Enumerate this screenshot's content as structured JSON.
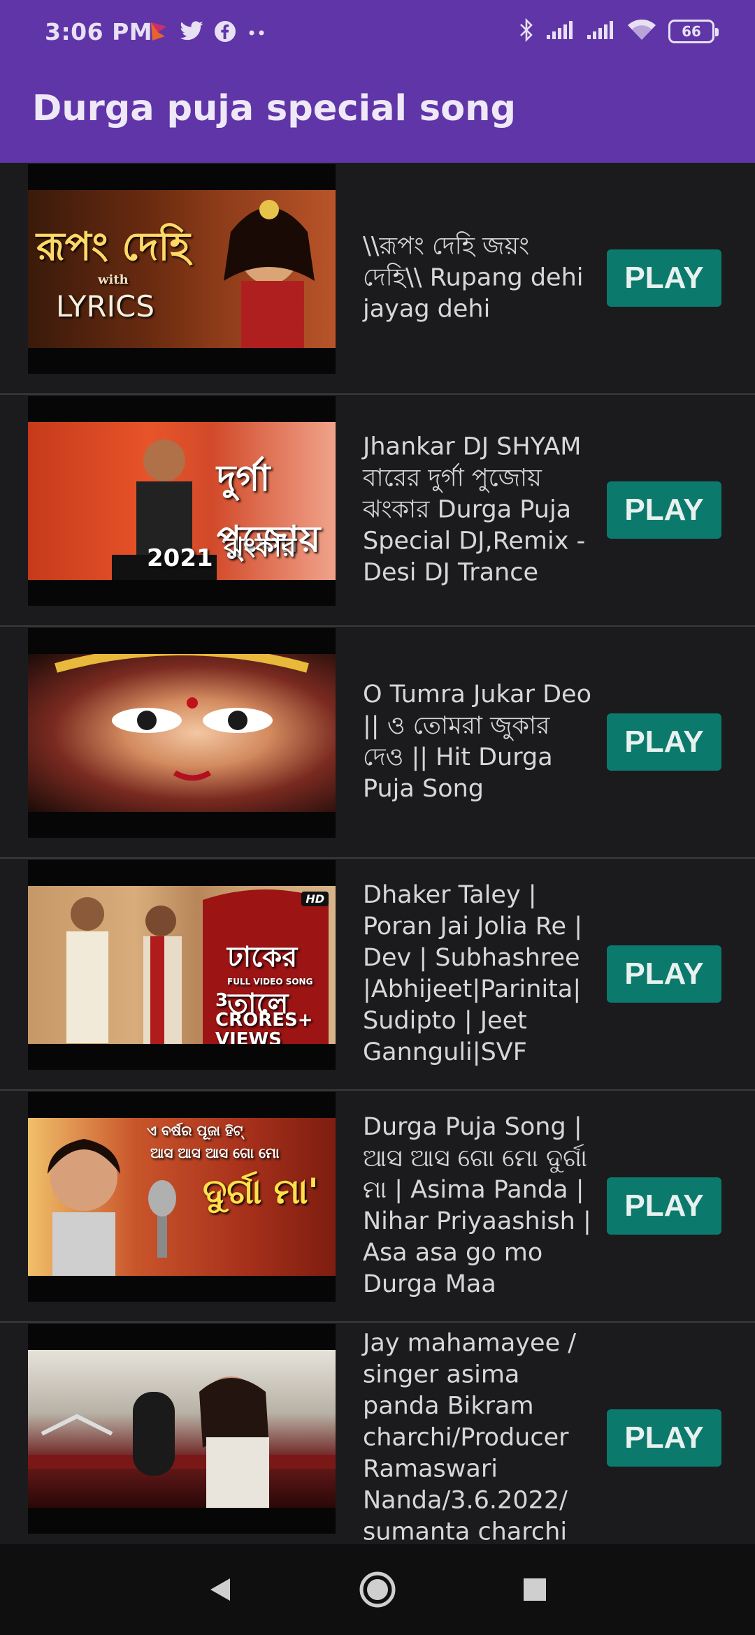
{
  "status_bar": {
    "time": "3:06 PM",
    "battery_level": "66",
    "left_icons": [
      "app-notification-icon",
      "twitter-icon",
      "facebook-icon",
      "more-dots-icon"
    ],
    "right_icons": [
      "bluetooth-icon",
      "signal-icon",
      "signal-icon",
      "wifi-icon",
      "battery-icon"
    ]
  },
  "app_bar": {
    "title": "Durga puja special song",
    "background": "#5f35a8"
  },
  "songs": [
    {
      "title": "\\\\রূপং দেহি জয়ং দেহি\\\\ Rupang dehi jayag dehi",
      "button": "PLAY",
      "thumb_text_main": "রূপং দেহি",
      "thumb_text_sub": "with",
      "thumb_text_extra": "LYRICS"
    },
    {
      "title": "Jhankar DJ SHYAM বারের দুর্গা পুজোয় ঝংকার Durga Puja Special DJ,Remix - Desi DJ Trance",
      "button": "PLAY",
      "thumb_text_main": "দুর্গা পুজোয়",
      "thumb_text_sub": "ঝংকার",
      "thumb_text_extra": "2021"
    },
    {
      "title": "O Tumra Jukar Deo || ও তোমরা জুকার দেও || Hit Durga Puja Song",
      "button": "PLAY"
    },
    {
      "title": "Dhaker Taley | Poran Jai Jolia Re | Dev | Subhashree |Abhijeet|Parinita| Sudipto | Jeet Gannguli|SVF",
      "button": "PLAY",
      "thumb_text_main": "ঢাকের তালে",
      "thumb_text_sub": "FULL VIDEO SONG",
      "thumb_text_extra": "3 CRORES+ VIEWS",
      "badge": "HD"
    },
    {
      "title": "Durga Puja Song | ଆସ ଆସ ଗୋ ମୋ ଦୁର୍ଗା ମା | Asima Panda | Nihar Priyaashish | Asa asa go mo Durga Maa",
      "button": "PLAY",
      "thumb_text_main": "ଦୁର୍ଗା ମା'",
      "thumb_text_sub": "ଏ ବର୍ଷର ପୂଜା ହିଟ୍",
      "thumb_text_extra": "ଆସ ଆସ ଆସ ଗୋ ମୋ"
    },
    {
      "title": "Jay mahamayee / singer asima panda Bikram charchi/Producer Ramaswari Nanda/3.6.2022/ sumanta charchi",
      "button": "PLAY"
    }
  ],
  "navigation": {
    "back": "back-icon",
    "home": "home-icon",
    "recents": "recents-icon"
  }
}
